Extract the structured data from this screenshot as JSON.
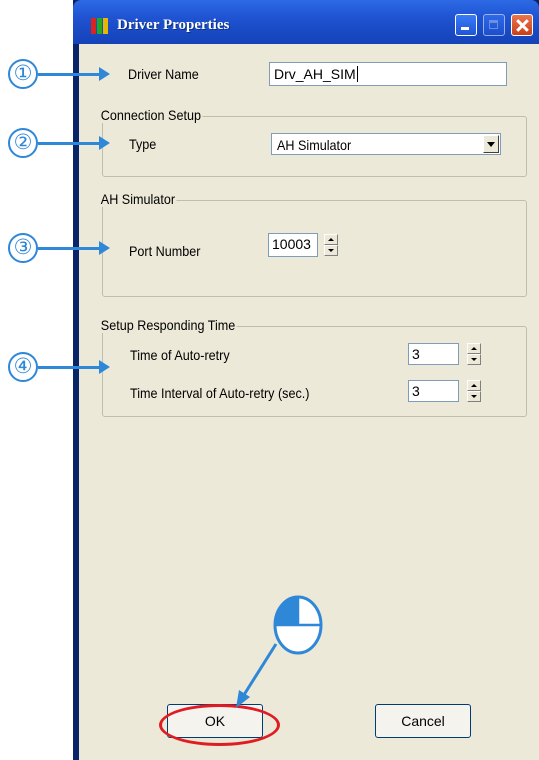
{
  "window": {
    "title": "Driver Properties",
    "icon": "app-icon"
  },
  "driver_name": {
    "label": "Driver Name",
    "value": "Drv_AH_SIM"
  },
  "connection_setup": {
    "group_title": "Connection Setup",
    "type_label": "Type",
    "type_value": "AH Simulator"
  },
  "ah_simulator": {
    "group_title": "AH Simulator",
    "port_label": "Port Number",
    "port_value": "10003"
  },
  "responding_time": {
    "group_title": "Setup Responding Time",
    "retry_label": "Time of Auto-retry",
    "retry_value": "3",
    "interval_label": "Time Interval of Auto-retry (sec.)",
    "interval_value": "3"
  },
  "buttons": {
    "ok": "OK",
    "cancel": "Cancel"
  },
  "callouts": [
    "①",
    "②",
    "③",
    "④"
  ],
  "colors": {
    "callout": "#2f87d8",
    "highlight": "#e01b22",
    "titlebar": "#1f53d1"
  }
}
